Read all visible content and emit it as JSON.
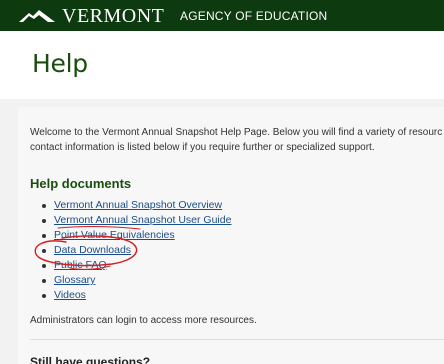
{
  "header": {
    "logo_icon": "vermont-mountain-logo-icon",
    "wordmark": "VERMONT",
    "agency": "AGENCY OF EDUCATION",
    "background_color": "#0d3a0f"
  },
  "page": {
    "title": "Help"
  },
  "intro": {
    "line1": "Welcome to the Vermont Annual Snapshot Help Page. Below you will find a variety of resourc",
    "line2": "contact information is listed below if you require further or specialized support."
  },
  "help_documents": {
    "heading": "Help documents",
    "items": [
      {
        "label": "Vermont Annual Snapshot Overview"
      },
      {
        "label": "Vermont Annual Snapshot User Guide"
      },
      {
        "label": "Point Value Equivalencies"
      },
      {
        "label": "Data Downloads"
      },
      {
        "label": "Public FAQ"
      },
      {
        "label": "Glossary"
      },
      {
        "label": "Videos"
      }
    ]
  },
  "admin_note": "Administrators can login to access more resources.",
  "still_questions": {
    "heading": "Still have questions?"
  },
  "colors": {
    "title_green": "#1a4d0f",
    "link_blue": "#1a4d8a",
    "annotation_red": "#d21f1f"
  }
}
